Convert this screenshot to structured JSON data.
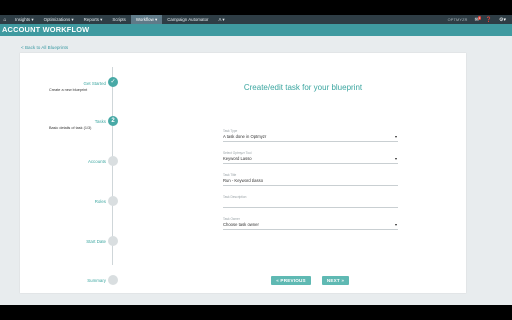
{
  "nav": {
    "home_icon": "home-icon",
    "items": [
      {
        "label": "Insights ▾"
      },
      {
        "label": "Optimizations ▾"
      },
      {
        "label": "Reports ▾"
      },
      {
        "label": "Scripts"
      },
      {
        "label": "Workflow ▾"
      },
      {
        "label": "Campaign Automator"
      },
      {
        "label": "Λ ▾"
      }
    ],
    "active_index": 4,
    "client": "OPTMYZR",
    "notification_count": "1"
  },
  "title": "ACCOUNT WORKFLOW",
  "back_link": "< Back to All Blueprints",
  "steps": [
    {
      "label": "Get Started",
      "sub": "Create a new blueprint",
      "state": "done"
    },
    {
      "label": "Tasks",
      "sub": "Basic details of task (1/3)",
      "state": "current",
      "number": "2"
    },
    {
      "label": "Accounts",
      "sub": "",
      "state": "todo"
    },
    {
      "label": "Roles",
      "sub": "",
      "state": "todo"
    },
    {
      "label": "Start Date",
      "sub": "",
      "state": "todo"
    },
    {
      "label": "Summary",
      "sub": "",
      "state": "todo"
    }
  ],
  "form": {
    "title": "Create/edit task for your blueprint",
    "fields": [
      {
        "label": "Task Type",
        "value": "A task done in Optmyzr",
        "type": "select"
      },
      {
        "label": "Select Optmyzr Tool",
        "value": "Keyword Lasso",
        "type": "select"
      },
      {
        "label": "Task Title",
        "value": "Run - Keyword Lasso",
        "type": "text"
      },
      {
        "label": "Task Description",
        "value": "",
        "type": "text"
      },
      {
        "label": "Task Owner",
        "value": "Choose task owner",
        "type": "select"
      }
    ],
    "prev_label": "« PREVIOUS",
    "next_label": "NEXT »"
  },
  "colors": {
    "accent": "#3f9aa0",
    "nav_bg": "#2e3d45",
    "button": "#5fb9b3"
  }
}
